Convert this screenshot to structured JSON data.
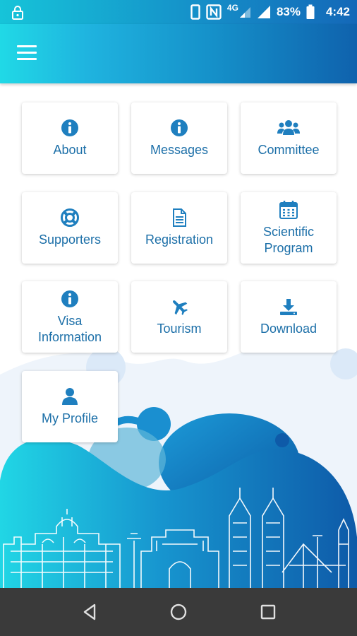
{
  "status_bar": {
    "network": "4G",
    "battery": "83%",
    "time": "4:42"
  },
  "app_bar": {
    "menu_icon": "hamburger-menu-icon"
  },
  "tiles": [
    {
      "label": "About",
      "icon": "info-circle-icon"
    },
    {
      "label": "Messages",
      "icon": "info-circle-icon"
    },
    {
      "label": "Committee",
      "icon": "users-group-icon"
    },
    {
      "label": "Supporters",
      "icon": "life-ring-icon"
    },
    {
      "label": "Registration",
      "icon": "document-icon"
    },
    {
      "label": "Scientific\nProgram",
      "icon": "calendar-icon"
    },
    {
      "label": "Visa\nInformation",
      "icon": "info-circle-icon"
    },
    {
      "label": "Tourism",
      "icon": "airplane-icon"
    },
    {
      "label": "Download",
      "icon": "download-icon"
    },
    {
      "label": "My Profile",
      "icon": "user-icon"
    }
  ],
  "colors": {
    "accent": "#1c6fa8",
    "icon": "#1f7fbf",
    "header_start": "#20d9e6",
    "header_end": "#0f62ad"
  },
  "nav_bar": {
    "buttons": [
      "back-icon",
      "home-icon",
      "recents-icon"
    ]
  }
}
